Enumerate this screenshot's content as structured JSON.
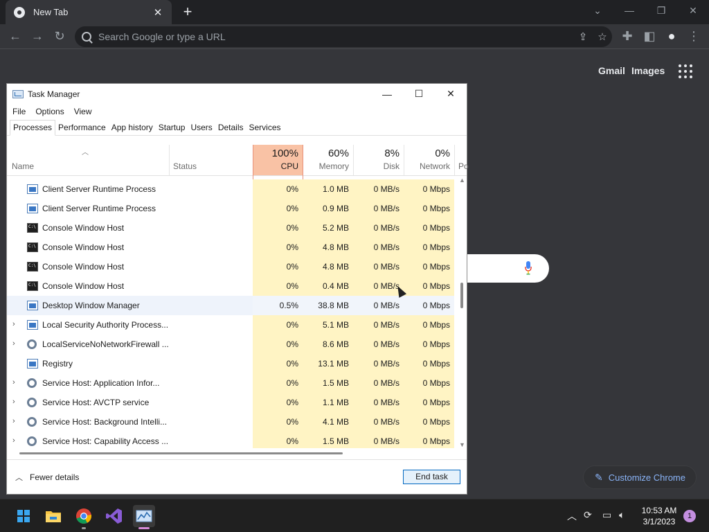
{
  "chrome": {
    "tab_title": "New Tab",
    "tab_close": "✕",
    "new_tab": "+",
    "omnibox_placeholder": "Search Google or type a URL",
    "ntp_links": [
      "Gmail",
      "Images"
    ],
    "customize_label": "Customize Chrome"
  },
  "task_manager": {
    "title": "Task Manager",
    "menu": [
      "File",
      "Options",
      "View"
    ],
    "tabs": [
      "Processes",
      "Performance",
      "App history",
      "Startup",
      "Users",
      "Details",
      "Services"
    ],
    "active_tab": "Processes",
    "columns": {
      "name": "Name",
      "status": "Status",
      "cpu": {
        "pct": "100%",
        "label": "CPU"
      },
      "memory": {
        "pct": "60%",
        "label": "Memory"
      },
      "disk": {
        "pct": "8%",
        "label": "Disk"
      },
      "network": {
        "pct": "0%",
        "label": "Network"
      },
      "power_partial": "Po"
    },
    "processes": [
      {
        "name": "Client Server Runtime Process",
        "icon": "window-icon",
        "expandable": false,
        "cpu": "0%",
        "memory": "1.0 MB",
        "disk": "0 MB/s",
        "network": "0 Mbps"
      },
      {
        "name": "Client Server Runtime Process",
        "icon": "window-icon",
        "expandable": false,
        "cpu": "0%",
        "memory": "0.9 MB",
        "disk": "0 MB/s",
        "network": "0 Mbps"
      },
      {
        "name": "Console Window Host",
        "icon": "console-icon",
        "expandable": false,
        "cpu": "0%",
        "memory": "5.2 MB",
        "disk": "0 MB/s",
        "network": "0 Mbps"
      },
      {
        "name": "Console Window Host",
        "icon": "console-icon",
        "expandable": false,
        "cpu": "0%",
        "memory": "4.8 MB",
        "disk": "0 MB/s",
        "network": "0 Mbps"
      },
      {
        "name": "Console Window Host",
        "icon": "console-icon",
        "expandable": false,
        "cpu": "0%",
        "memory": "4.8 MB",
        "disk": "0 MB/s",
        "network": "0 Mbps"
      },
      {
        "name": "Console Window Host",
        "icon": "console-icon",
        "expandable": false,
        "cpu": "0%",
        "memory": "0.4 MB",
        "disk": "0 MB/s",
        "network": "0 Mbps"
      },
      {
        "name": "Desktop Window Manager",
        "icon": "window-icon",
        "expandable": false,
        "selected": true,
        "cpu": "0.5%",
        "memory": "38.8 MB",
        "disk": "0 MB/s",
        "network": "0 Mbps"
      },
      {
        "name": "Local Security Authority Process...",
        "icon": "window-icon",
        "expandable": true,
        "cpu": "0%",
        "memory": "5.1 MB",
        "disk": "0 MB/s",
        "network": "0 Mbps"
      },
      {
        "name": "LocalServiceNoNetworkFirewall ...",
        "icon": "gear-icon",
        "expandable": true,
        "cpu": "0%",
        "memory": "8.6 MB",
        "disk": "0 MB/s",
        "network": "0 Mbps"
      },
      {
        "name": "Registry",
        "icon": "window-icon",
        "expandable": false,
        "cpu": "0%",
        "memory": "13.1 MB",
        "disk": "0 MB/s",
        "network": "0 Mbps"
      },
      {
        "name": "Service Host: Application Infor...",
        "icon": "gear-icon",
        "expandable": true,
        "cpu": "0%",
        "memory": "1.5 MB",
        "disk": "0 MB/s",
        "network": "0 Mbps"
      },
      {
        "name": "Service Host: AVCTP service",
        "icon": "gear-icon",
        "expandable": true,
        "cpu": "0%",
        "memory": "1.1 MB",
        "disk": "0 MB/s",
        "network": "0 Mbps"
      },
      {
        "name": "Service Host: Background Intelli...",
        "icon": "gear-icon",
        "expandable": true,
        "cpu": "0%",
        "memory": "4.1 MB",
        "disk": "0 MB/s",
        "network": "0 Mbps"
      },
      {
        "name": "Service Host: Capability Access ...",
        "icon": "gear-icon",
        "expandable": true,
        "cpu": "0%",
        "memory": "1.5 MB",
        "disk": "0 MB/s",
        "network": "0 Mbps"
      }
    ],
    "fewer_details": "Fewer details",
    "end_task": "End task"
  },
  "taskbar": {
    "time": "10:53 AM",
    "date": "3/1/2023",
    "notification_count": "1",
    "apps": [
      "start-icon",
      "file-explorer-icon",
      "chrome-icon",
      "visual-studio-icon",
      "task-manager-icon"
    ]
  },
  "colors": {
    "cpu_header": "#f9c2a5",
    "heat_cell": "#fff4c4",
    "accent": "#0067c0"
  }
}
